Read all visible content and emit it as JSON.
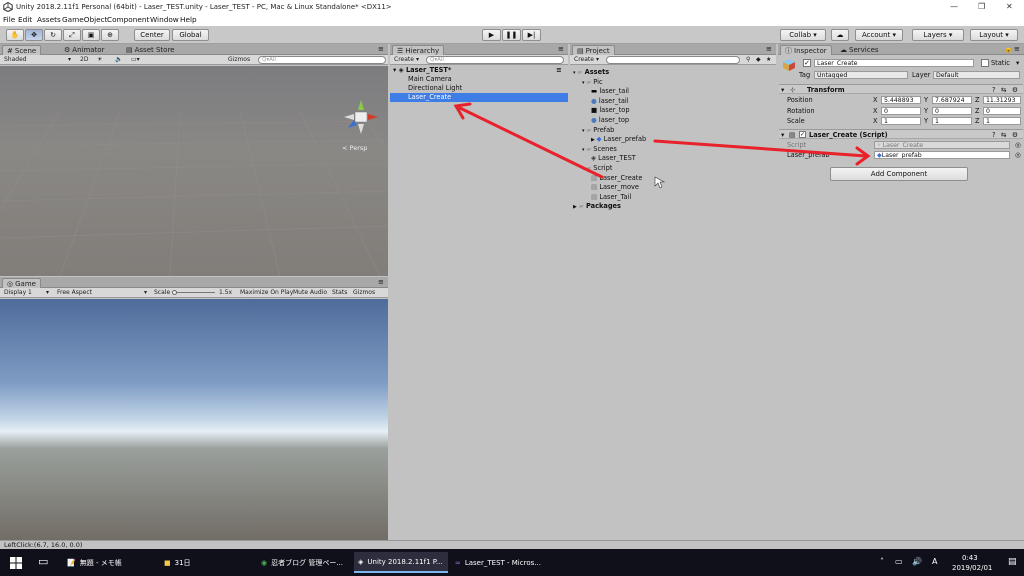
{
  "window": {
    "title": "Unity 2018.2.11f1 Personal (64bit) - Laser_TEST.unity - Laser_TEST - PC, Mac & Linux Standalone* <DX11>"
  },
  "menu": [
    "File",
    "Edit",
    "Assets",
    "GameObject",
    "Component",
    "Window",
    "Help"
  ],
  "toolbar": {
    "pivot": "Center",
    "space": "Global",
    "collab": "Collab",
    "account": "Account",
    "layers": "Layers",
    "layout": "Layout"
  },
  "scene": {
    "tabs": [
      "Scene",
      "Animator",
      "Asset Store"
    ],
    "shading": "Shaded",
    "mode2d": "2D",
    "gizmos": "Gizmos",
    "search_placeholder": "Q▾All",
    "persp": "< Persp"
  },
  "game": {
    "tab": "Game",
    "display": "Display 1",
    "aspect": "Free Aspect",
    "scale_label": "Scale",
    "scale_value": "1.5x",
    "maximize": "Maximize On Play",
    "mute": "Mute Audio",
    "stats": "Stats",
    "gizmos": "Gizmos"
  },
  "hierarchy": {
    "tab": "Hierarchy",
    "create": "Create",
    "search_placeholder": "Q▾All",
    "scene_name": "Laser_TEST*",
    "items": [
      "Main Camera",
      "Directional Light",
      "Laser_Create"
    ],
    "selected": "Laser_Create"
  },
  "project": {
    "tab": "Project",
    "create": "Create",
    "tree": [
      {
        "label": "Assets",
        "depth": 0,
        "kind": "folder",
        "bold": true
      },
      {
        "label": "Pic",
        "depth": 1,
        "kind": "folder"
      },
      {
        "label": "laser_tail",
        "depth": 2,
        "kind": "sprite-black"
      },
      {
        "label": "laser_tail",
        "depth": 2,
        "kind": "sphere"
      },
      {
        "label": "laser_top",
        "depth": 2,
        "kind": "sprite-dark"
      },
      {
        "label": "laser_top",
        "depth": 2,
        "kind": "sphere"
      },
      {
        "label": "Prefab",
        "depth": 1,
        "kind": "folder"
      },
      {
        "label": "Laser_prefab",
        "depth": 2,
        "kind": "prefab"
      },
      {
        "label": "Scenes",
        "depth": 1,
        "kind": "folder"
      },
      {
        "label": "Laser_TEST",
        "depth": 2,
        "kind": "unity"
      },
      {
        "label": "Script",
        "depth": 1,
        "kind": "folder"
      },
      {
        "label": "Laser_Create",
        "depth": 2,
        "kind": "script"
      },
      {
        "label": "Laser_move",
        "depth": 2,
        "kind": "script"
      },
      {
        "label": "Laser_Tail",
        "depth": 2,
        "kind": "script"
      },
      {
        "label": "Packages",
        "depth": 0,
        "kind": "folder",
        "bold": true
      }
    ]
  },
  "inspector": {
    "tabs": [
      "Inspector",
      "Services"
    ],
    "object_name": "Laser_Create",
    "static_label": "Static",
    "tag_label": "Tag",
    "tag_value": "Untagged",
    "layer_label": "Layer",
    "layer_value": "Default",
    "transform": {
      "title": "Transform",
      "position_label": "Position",
      "rotation_label": "Rotation",
      "scale_label": "Scale",
      "position": {
        "x": "5.448893",
        "y": "7.687924",
        "z": "11.31293"
      },
      "rotation": {
        "x": "0",
        "y": "0",
        "z": "0"
      },
      "scale": {
        "x": "1",
        "y": "1",
        "z": "1"
      }
    },
    "script_component": {
      "title": "Laser_Create (Script)",
      "script_label": "Script",
      "script_value": "Laser_Create",
      "prefab_label": "Laser_prefab",
      "prefab_value": "Laser_prefab"
    },
    "add_component": "Add Component"
  },
  "status": {
    "text": "LeftClick:(6.7, 16.0, 0.0)"
  },
  "taskbar": {
    "items": [
      "無題 - メモ帳",
      "31日",
      "忍者ブログ 管理ペー...",
      "Unity 2018.2.11f1 P...",
      "Laser_TEST - Micros..."
    ],
    "time": "0:43",
    "date": "2019/02/01"
  },
  "colors": {
    "selection": "#3e7ce6",
    "arrow": "#e8212b",
    "sky_top": "#5b7aa8",
    "ground": "#7a7570"
  }
}
